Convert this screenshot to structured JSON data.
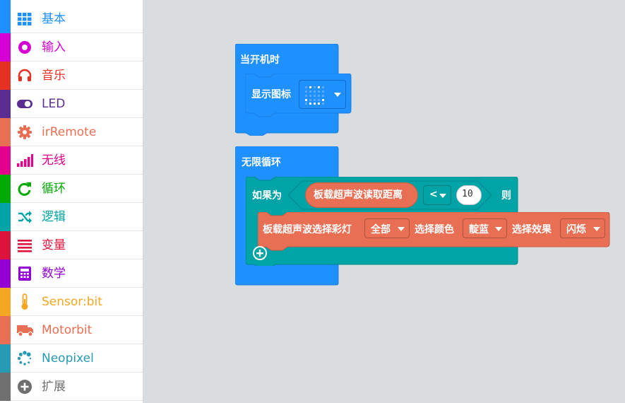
{
  "sidebar": {
    "items": [
      {
        "label": "基本",
        "icon": "grid-icon",
        "color": "#1e90ff"
      },
      {
        "label": "输入",
        "icon": "radio-circle-icon",
        "color": "#d400d4"
      },
      {
        "label": "音乐",
        "icon": "headphones-icon",
        "color": "#e63022"
      },
      {
        "label": "LED",
        "icon": "toggle-icon",
        "color": "#5c2d91"
      },
      {
        "label": "irRemote",
        "icon": "gear-icon",
        "color": "#e86f53"
      },
      {
        "label": "无线",
        "icon": "signal-bars-icon",
        "color": "#e3008c"
      },
      {
        "label": "循环",
        "icon": "refresh-icon",
        "color": "#00aa00"
      },
      {
        "label": "逻辑",
        "icon": "shuffle-icon",
        "color": "#00a4a6"
      },
      {
        "label": "变量",
        "icon": "list-lines-icon",
        "color": "#dc143c"
      },
      {
        "label": "数学",
        "icon": "calculator-icon",
        "color": "#9400d3"
      },
      {
        "label": "Sensor:bit",
        "icon": "thermometer-icon",
        "color": "#f5a623"
      },
      {
        "label": "Motorbit",
        "icon": "truck-icon",
        "color": "#e86f53"
      },
      {
        "label": "Neopixel",
        "icon": "dotted-circle-icon",
        "color": "#2699b4"
      },
      {
        "label": "扩展",
        "icon": "plus-circle-icon",
        "color": "#6f6f6f"
      }
    ]
  },
  "blocks": {
    "on_start": {
      "label": "当开机时",
      "color": "#1e90ff"
    },
    "show_icon": {
      "label": "显示图标"
    },
    "forever": {
      "label": "无限循环"
    },
    "if_block": {
      "if_label": "如果为",
      "then_label": "则",
      "color": "#00a4a6"
    },
    "distance_reporter": {
      "label": "板载超声波读取距离",
      "color": "#e86f53"
    },
    "compare_op": "<",
    "compare_value": "10",
    "rgb_block": {
      "label": "板载超声波选择彩灯",
      "led_value": "全部",
      "color_label": "选择颜色",
      "color_value": "靛蓝",
      "effect_label": "选择效果",
      "effect_value": "闪烁",
      "color": "#e86f53"
    }
  }
}
